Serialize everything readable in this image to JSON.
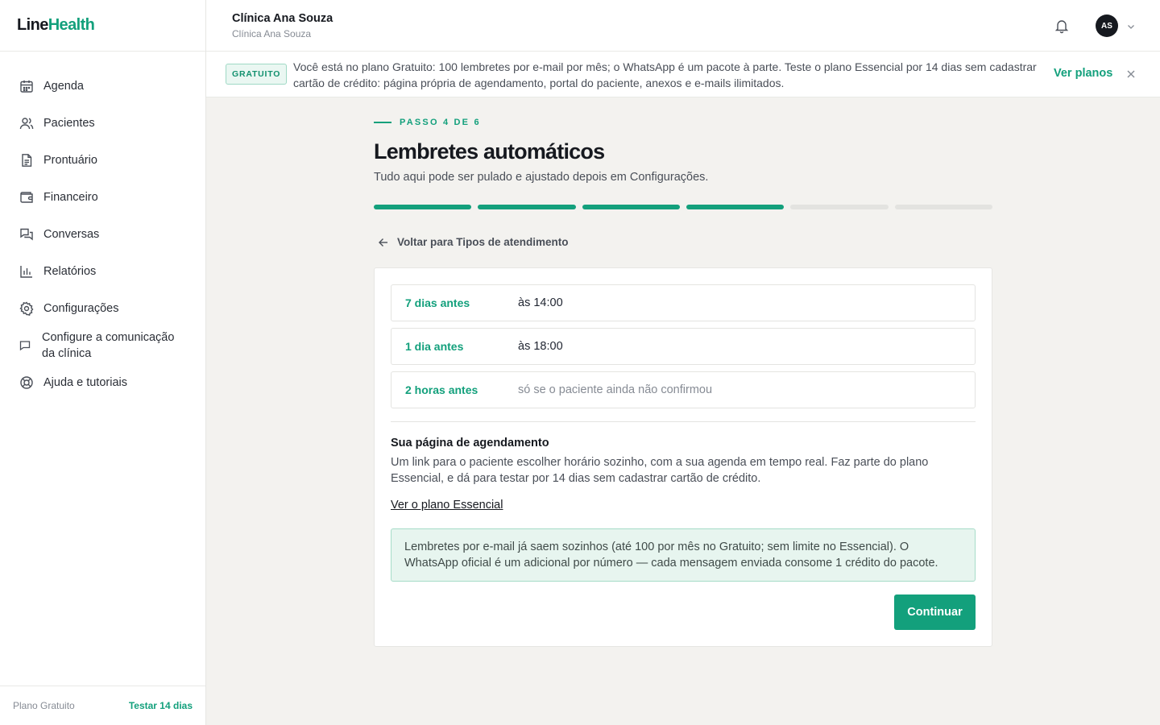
{
  "app": {
    "logo_prefix": "Line",
    "logo_suffix": "Health",
    "accent_color": "#13a07c"
  },
  "sidebar": {
    "items": [
      {
        "label": "Agenda",
        "icon": "calendar-icon"
      },
      {
        "label": "Pacientes",
        "icon": "users-icon"
      },
      {
        "label": "Prontuário",
        "icon": "document-icon"
      },
      {
        "label": "Financeiro",
        "icon": "wallet-icon"
      },
      {
        "label": "Conversas",
        "icon": "chat-icon"
      },
      {
        "label": "Relatórios",
        "icon": "bar-chart-icon"
      },
      {
        "label": "Configurações",
        "icon": "gear-icon"
      },
      {
        "label": "Configure a comunicação da clínica",
        "icon": "message-icon"
      },
      {
        "label": "Ajuda e tutoriais",
        "icon": "lifebuoy-icon"
      }
    ],
    "footer": {
      "plan": "Plano Gratuito",
      "trial": "Testar 14 dias"
    }
  },
  "header": {
    "title": "Clínica Ana Souza",
    "subtitle": "Clínica Ana Souza",
    "avatar_initials": "AS"
  },
  "banner": {
    "badge": "GRATUITO",
    "text": "Você está no plano Gratuito: 100 lembretes por e-mail por mês; o WhatsApp é um pacote à parte. Teste o plano Essencial por 14 dias sem cadastrar cartão de crédito: página própria de agendamento, portal do paciente, anexos e e-mails ilimitados.",
    "link": "Ver planos"
  },
  "wizard": {
    "step_label": "PASSO 4 DE 6",
    "current_step": 4,
    "total_steps": 6,
    "title": "Lembretes automáticos",
    "subtitle": "Tudo aqui pode ser pulado e ajustado depois em Configurações.",
    "back_label": "Voltar para Tipos de atendimento",
    "reminders": [
      {
        "when": "7 dias antes",
        "detail": "às 14:00"
      },
      {
        "when": "1 dia antes",
        "detail": "às 18:00"
      },
      {
        "when": "2 horas antes",
        "detail": "só se o paciente ainda não confirmou"
      }
    ],
    "booking_section": {
      "title": "Sua página de agendamento",
      "body": "Um link para o paciente escolher horário sozinho, com a sua agenda em tempo real. Faz parte do plano Essencial, e dá para testar por 14 dias sem cadastrar cartão de crédito.",
      "link": "Ver o plano Essencial"
    },
    "info_note": "Lembretes por e-mail já saem sozinhos (até 100 por mês no Gratuito; sem limite no Essencial). O WhatsApp oficial é um adicional por número — cada mensagem enviada consome 1 crédito do pacote.",
    "continue_label": "Continuar"
  }
}
